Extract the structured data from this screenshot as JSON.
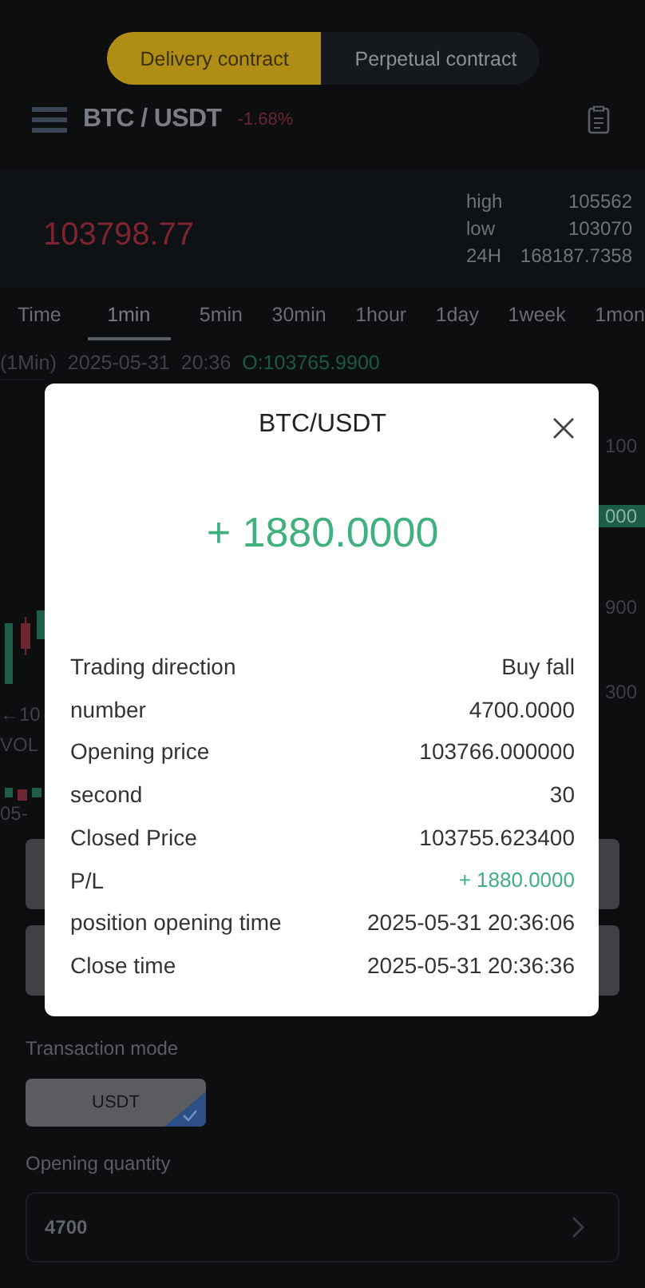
{
  "contract_tabs": [
    {
      "label": "Delivery contract",
      "selected": true
    },
    {
      "label": "Perpetual contract",
      "selected": false
    }
  ],
  "header": {
    "pair": "BTC / USDT",
    "change": "-1.68%"
  },
  "ticker": {
    "price": "103798.77",
    "stats": [
      {
        "label": "high",
        "value": "105562"
      },
      {
        "label": "low",
        "value": "103070"
      },
      {
        "label": "24H",
        "value": "168187.7358"
      }
    ]
  },
  "intervals": [
    {
      "label": "Time",
      "selected": false
    },
    {
      "label": "1min",
      "selected": true
    },
    {
      "label": "5min",
      "selected": false
    },
    {
      "label": "30min",
      "selected": false
    },
    {
      "label": "1hour",
      "selected": false
    },
    {
      "label": "1day",
      "selected": false
    },
    {
      "label": "1week",
      "selected": false
    },
    {
      "label": "1mon",
      "selected": false
    }
  ],
  "chart_info": {
    "period": "(1Min)",
    "date": "2025-05-31",
    "time": "20:36",
    "open": "O:103765.9900"
  },
  "chart": {
    "left_labels": [
      "←10",
      "VOL",
      "05-"
    ],
    "price_labels": [
      {
        "text": "100",
        "highlighted": false
      },
      {
        "text": "000",
        "highlighted": true
      },
      {
        "text": "900",
        "highlighted": false
      },
      {
        "text": "300",
        "highlighted": false
      }
    ]
  },
  "modal": {
    "title": "BTC/USDT",
    "amount": "+ 1880.0000",
    "rows": [
      {
        "label": "Trading direction",
        "value": "Buy fall",
        "positive": false
      },
      {
        "label": "number",
        "value": "4700.0000",
        "positive": false
      },
      {
        "label": "Opening price",
        "value": "103766.000000",
        "positive": false
      },
      {
        "label": "second",
        "value": "30",
        "positive": false
      },
      {
        "label": "Closed Price",
        "value": "103755.623400",
        "positive": false
      },
      {
        "label": "P/L",
        "value": "+ 1880.0000",
        "positive": true
      },
      {
        "label": "position opening time",
        "value": "2025-05-31 20:36:06",
        "positive": false
      },
      {
        "label": "Close time",
        "value": "2025-05-31 20:36:36",
        "positive": false
      }
    ]
  },
  "transaction_mode": {
    "label": "Transaction mode",
    "options": [
      {
        "label": "USDT",
        "selected": true
      }
    ]
  },
  "opening_quantity": {
    "label": "Opening quantity",
    "value": "4700"
  }
}
